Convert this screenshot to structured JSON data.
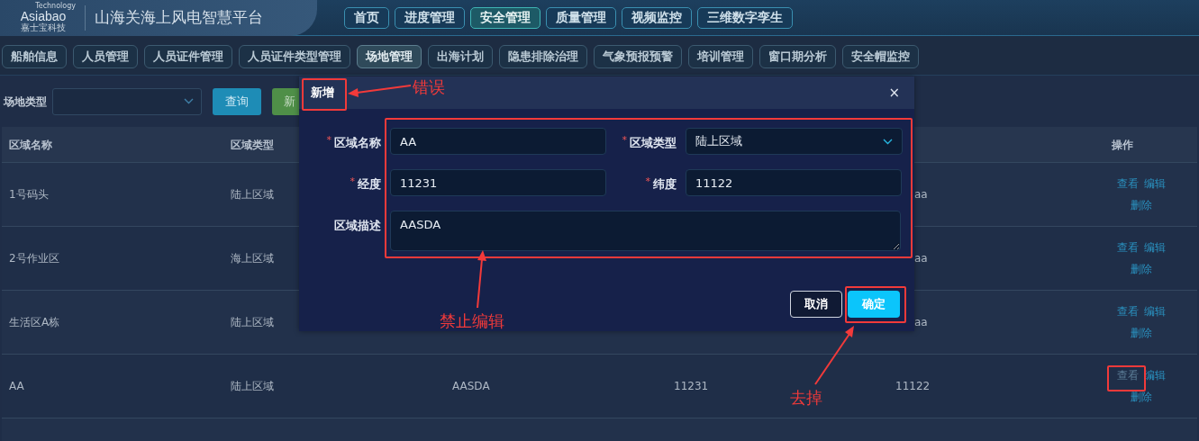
{
  "header": {
    "logo_text": "Asiabao",
    "logo_tagline": "Technology",
    "logo_subtext": "嘉士宝科技",
    "title": "山海关海上风电智慧平台",
    "nav": [
      {
        "label": "首页",
        "selected": false
      },
      {
        "label": "进度管理",
        "selected": false
      },
      {
        "label": "安全管理",
        "selected": true
      },
      {
        "label": "质量管理",
        "selected": false
      },
      {
        "label": "视频监控",
        "selected": false
      },
      {
        "label": "三维数字孪生",
        "selected": false
      }
    ]
  },
  "subnav": [
    {
      "label": "船舶信息",
      "selected": false
    },
    {
      "label": "人员管理",
      "selected": false
    },
    {
      "label": "人员证件管理",
      "selected": false
    },
    {
      "label": "人员证件类型管理",
      "selected": false
    },
    {
      "label": "场地管理",
      "selected": true
    },
    {
      "label": "出海计划",
      "selected": false
    },
    {
      "label": "隐患排除治理",
      "selected": false
    },
    {
      "label": "气象预报预警",
      "selected": false
    },
    {
      "label": "培训管理",
      "selected": false
    },
    {
      "label": "窗口期分析",
      "selected": false
    },
    {
      "label": "安全帽监控",
      "selected": false
    }
  ],
  "filter": {
    "label": "场地类型",
    "buttons": [
      {
        "label": "查询",
        "kind": "primary"
      },
      {
        "label": "新",
        "kind": "success"
      }
    ]
  },
  "table": {
    "columns": {
      "column_1": "区域名称",
      "column_2": "区域类型",
      "actions": "操作"
    },
    "rows": [
      {
        "column_1": "1号码头",
        "column_2": "陆上区域",
        "column_5": "aa",
        "actions": [
          {
            "label": "查看",
            "disabled": false
          },
          {
            "label": "编辑",
            "disabled": false
          },
          {
            "label": "删除",
            "disabled": false
          }
        ]
      },
      {
        "column_1": "2号作业区",
        "column_2": "海上区域",
        "column_5": "aa",
        "actions": [
          {
            "label": "查看",
            "disabled": false
          },
          {
            "label": "编辑",
            "disabled": false
          },
          {
            "label": "删除",
            "disabled": false
          }
        ]
      },
      {
        "column_1": "生活区A栋",
        "column_2": "陆上区域",
        "column_5": "aa",
        "actions": [
          {
            "label": "查看",
            "disabled": false
          },
          {
            "label": "编辑",
            "disabled": false
          },
          {
            "label": "删除",
            "disabled": false
          }
        ]
      },
      {
        "column_1": "AA",
        "column_2": "陆上区域",
        "column_3": "AASDA",
        "column_4": "11231",
        "column_5": "11122",
        "actions": [
          {
            "label": "查看",
            "disabled": true
          },
          {
            "label": "编辑",
            "disabled": false
          },
          {
            "label": "删除",
            "disabled": false
          }
        ]
      },
      {
        "actions": []
      }
    ]
  },
  "dialog": {
    "title": "新增",
    "close": "×",
    "fields": [
      {
        "label": "区域名称",
        "required_mark": "*",
        "kind": "input",
        "value": "AA"
      },
      {
        "label": "区域类型",
        "required_mark": "*",
        "kind": "select",
        "value": "陆上区域"
      },
      {
        "label": "经度",
        "required_mark": "*",
        "kind": "input",
        "value": "11231"
      },
      {
        "label": "纬度",
        "required_mark": "*",
        "kind": "input",
        "value": "11122"
      },
      {
        "label": "区域描述",
        "kind": "textarea",
        "value": "AASDA"
      }
    ],
    "buttons": [
      {
        "label": "取消",
        "kind": "default"
      },
      {
        "label": "确定",
        "kind": "primary"
      }
    ]
  },
  "annotations": [
    "错误",
    "禁止编辑",
    "去掉"
  ]
}
